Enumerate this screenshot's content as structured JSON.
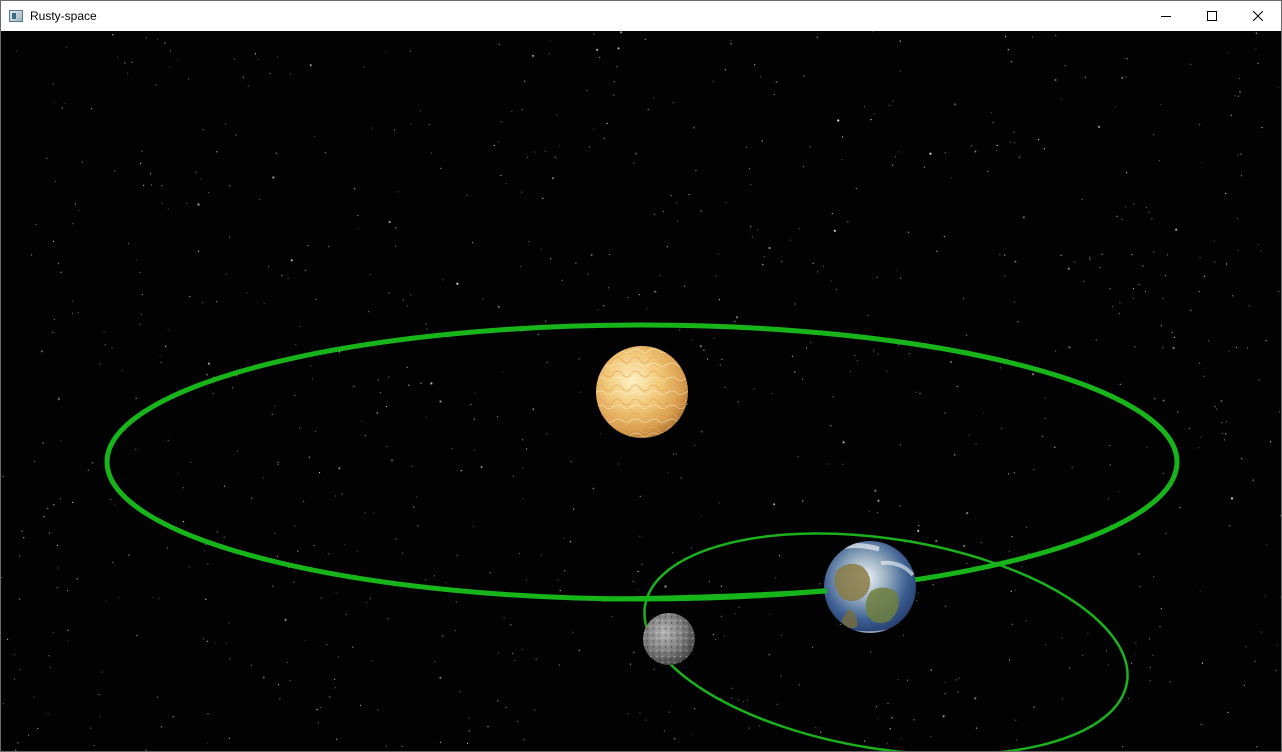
{
  "window": {
    "title": "Rusty-space",
    "app_icon": "window-app-icon"
  },
  "controls": {
    "minimize_icon": "minimize-icon",
    "maximize_icon": "maximize-icon",
    "close_icon": "close-icon"
  },
  "scene": {
    "background_color": "#020203",
    "orbit_color": "#17b51a",
    "bodies": [
      {
        "name": "sun-body",
        "colors": [
          "#fbe6a8",
          "#e9b262",
          "#c98b3b"
        ]
      },
      {
        "name": "earth-body",
        "colors": [
          "#dfe9f3",
          "#3a5f9a",
          "#7a8a4a"
        ]
      },
      {
        "name": "moon-body",
        "colors": [
          "#9a9a9a",
          "#6e6e6e",
          "#4a4a4a"
        ]
      }
    ]
  }
}
